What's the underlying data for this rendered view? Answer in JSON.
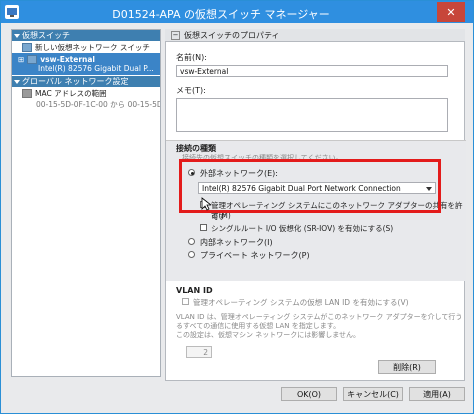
{
  "window": {
    "title": "D01524-APA の仮想スイッチ マネージャー",
    "close": "✕"
  },
  "sidebar": {
    "cat_switches": "仮想スイッチ",
    "new_switch": "新しい仮想ネットワーク スイッチ",
    "vsw_name": "vsw-External",
    "vsw_adapter": "Intel(R) 82576 Gigabit Dual P...",
    "cat_global": "グローバル ネットワーク設定",
    "mac_range": "MAC アドレスの範囲",
    "mac_value": "00-15-5D-0F-1C-00 から 00-15-5D-..."
  },
  "props": {
    "header": "仮想スイッチのプロパティ",
    "name_label": "名前(N):",
    "name_value": "vsw-External",
    "notes_label": "メモ(T):",
    "conn_type_label": "接続の種類",
    "conn_type_hint": "接続先の仮想スイッチの種類を選択してください。",
    "external_label": "外部ネットワーク(E):",
    "adapter_value": "Intel(R) 82576 Gigabit Dual Port Network Connection",
    "allow_mgmt_line1": "管理オペレーティング システムにこのネットワーク アダプターの共有を許可す",
    "allow_mgmt_line2": "る(M)",
    "sriov_label": "シングルルート I/O 仮想化 (SR-IOV) を有効にする(S)",
    "internal_label": "内部ネットワーク(I)",
    "private_label": "プライベート ネットワーク(P)",
    "vlan_title": "VLAN ID",
    "vlan_check": "管理オペレーティング システムの仮想 LAN ID を有効にする(V)",
    "vlan_desc1": "VLAN ID は、管理オペレーティング システムがこのネットワーク アダプターを介して行う",
    "vlan_desc2": "るすべての通信に使用する仮想 LAN を指定します。",
    "vlan_desc3": "この設定は、仮想マシン ネットワークには影響しません。",
    "vlan_value": "2",
    "remove_button": "削除(R)"
  },
  "footer": {
    "ok": "OK(O)",
    "cancel": "キャンセル(C)",
    "apply": "適用(A)"
  }
}
